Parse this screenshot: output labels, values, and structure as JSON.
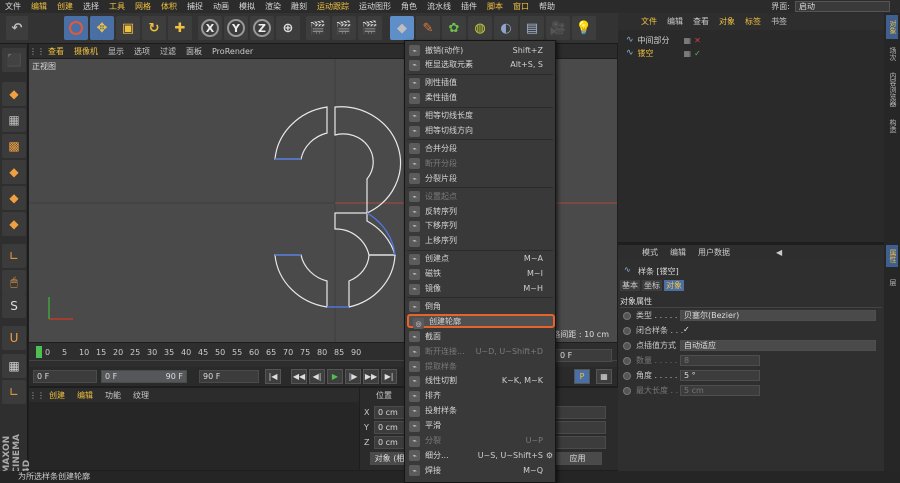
{
  "menubar": {
    "items": [
      "文件",
      "编辑",
      "创建",
      "选择",
      "工具",
      "网格",
      "体积",
      "捕捉",
      "动画",
      "模拟",
      "渲染",
      "雕刻",
      "运动跟踪",
      "运动图形",
      "角色",
      "流水线",
      "插件",
      "脚本",
      "窗口",
      "帮助"
    ],
    "highlight": [
      1,
      2,
      4,
      5,
      6,
      12,
      17,
      18
    ],
    "layout_label": "界面:",
    "layout_value": "启动"
  },
  "toolbar": {
    "xyz": [
      "X",
      "Y",
      "Z"
    ]
  },
  "viewport": {
    "menu": [
      "查看",
      "摄像机",
      "显示",
      "选项",
      "过滤",
      "面板",
      "ProRender"
    ],
    "menu_highlight": [
      0,
      1
    ],
    "label": "正视图",
    "grid_distance": "网格间距 : 10 cm"
  },
  "timeline": {
    "ticks": [
      "0",
      "5",
      "10",
      "15",
      "20",
      "25",
      "30",
      "35",
      "40",
      "45",
      "50",
      "55",
      "60",
      "65",
      "70",
      "75",
      "80",
      "85",
      "90"
    ],
    "end_frame": "0 F",
    "start_field": "0 F",
    "range_left": "0 F",
    "range_right": "90 F",
    "end_field": "90 F"
  },
  "material": {
    "menu": [
      "创建",
      "编辑",
      "功能",
      "纹理"
    ],
    "menu_highlight": [
      0,
      1
    ]
  },
  "coords": {
    "header": "位置",
    "rows": [
      {
        "axis": "X",
        "value": "0 cm"
      },
      {
        "axis": "Y",
        "value": "0 cm"
      },
      {
        "axis": "Z",
        "value": "0 cm"
      }
    ],
    "object_button": "对象 (相",
    "apply_button": "应用"
  },
  "status": "为所选样条创建轮廓",
  "context_menu": {
    "items": [
      {
        "label": "撤销(动作)",
        "shortcut": "Shift+Z",
        "disabled": false
      },
      {
        "label": "框显选取元素",
        "shortcut": "Alt+S, S",
        "disabled": false
      },
      {
        "sep": true
      },
      {
        "label": "刚性插值",
        "shortcut": "",
        "disabled": false
      },
      {
        "label": "柔性插值",
        "shortcut": "",
        "disabled": false
      },
      {
        "sep": true
      },
      {
        "label": "相等切线长度",
        "shortcut": "",
        "disabled": false
      },
      {
        "label": "相等切线方向",
        "shortcut": "",
        "disabled": false
      },
      {
        "sep": true
      },
      {
        "label": "合并分段",
        "shortcut": "",
        "disabled": false
      },
      {
        "label": "断开分段",
        "shortcut": "",
        "disabled": true
      },
      {
        "label": "分裂片段",
        "shortcut": "",
        "disabled": false
      },
      {
        "sep": true
      },
      {
        "label": "设置起点",
        "shortcut": "",
        "disabled": true
      },
      {
        "label": "反转序列",
        "shortcut": "",
        "disabled": false
      },
      {
        "label": "下移序列",
        "shortcut": "",
        "disabled": false
      },
      {
        "label": "上移序列",
        "shortcut": "",
        "disabled": false
      },
      {
        "sep": true
      },
      {
        "label": "创建点",
        "shortcut": "M~A",
        "disabled": false
      },
      {
        "label": "磁铁",
        "shortcut": "M~I",
        "disabled": false
      },
      {
        "label": "镜像",
        "shortcut": "M~H",
        "disabled": false
      },
      {
        "sep": true
      },
      {
        "label": "倒角",
        "shortcut": "",
        "disabled": false
      },
      {
        "label": "创建轮廓",
        "shortcut": "",
        "disabled": false,
        "hover": true
      },
      {
        "label": "截面",
        "shortcut": "",
        "disabled": false
      },
      {
        "label": "断开连接...",
        "shortcut": "U~D, U~Shift+D",
        "disabled": true
      },
      {
        "label": "提取样条",
        "shortcut": "",
        "disabled": true
      },
      {
        "label": "线性切割",
        "shortcut": "K~K, M~K",
        "disabled": false
      },
      {
        "label": "排齐",
        "shortcut": "",
        "disabled": false
      },
      {
        "label": "投射样条",
        "shortcut": "",
        "disabled": false
      },
      {
        "label": "平滑",
        "shortcut": "",
        "disabled": false
      },
      {
        "label": "分裂",
        "shortcut": "U~P",
        "disabled": true
      },
      {
        "label": "细分...",
        "shortcut": "U~S, U~Shift+S",
        "disabled": false
      },
      {
        "label": "焊接",
        "shortcut": "M~Q",
        "disabled": false
      }
    ]
  },
  "objects": {
    "menu": [
      "文件",
      "编辑",
      "查看",
      "对象",
      "标签",
      "书签"
    ],
    "menu_highlight": [
      0,
      3,
      4
    ],
    "rows": [
      {
        "name": "中间部分",
        "selected": false
      },
      {
        "name": "镂空",
        "selected": true
      }
    ]
  },
  "attributes": {
    "menu": [
      "模式",
      "编辑",
      "用户数据"
    ],
    "object_title": "样条 [镂空]",
    "tabs": [
      "基本",
      "坐标",
      "对象"
    ],
    "active_tab": 2,
    "section": "对象属性",
    "rows": [
      {
        "label": "类型 . . . . . . . .",
        "value": "贝塞尔(Bezier)",
        "check": false
      },
      {
        "label": "闭合样条 . . .",
        "value": "✓",
        "check": true
      },
      {
        "label": "点插值方式",
        "value": "自动适应",
        "check": false
      },
      {
        "label": "数量 . . . . . . . .",
        "value": "8",
        "check": false,
        "dim": true
      },
      {
        "label": "角度 . . . . . . . .",
        "value": "5 °",
        "check": false
      },
      {
        "label": "最大长度 . . .",
        "value": "5 cm",
        "check": false,
        "dim": true
      }
    ]
  },
  "side_tabs": [
    "对象",
    "场次",
    "内容浏览器",
    "构造"
  ],
  "side_tabs_lower": [
    "属性",
    "层"
  ],
  "brand": "MAXON CINEMA 4D",
  "colors": {
    "accent_orange": "#e8622c",
    "highlight_yellow": "#f0c040",
    "axis_red": "#c0392b",
    "spline_white": "#e8e8e8",
    "spline_blue": "#4f74d8"
  }
}
